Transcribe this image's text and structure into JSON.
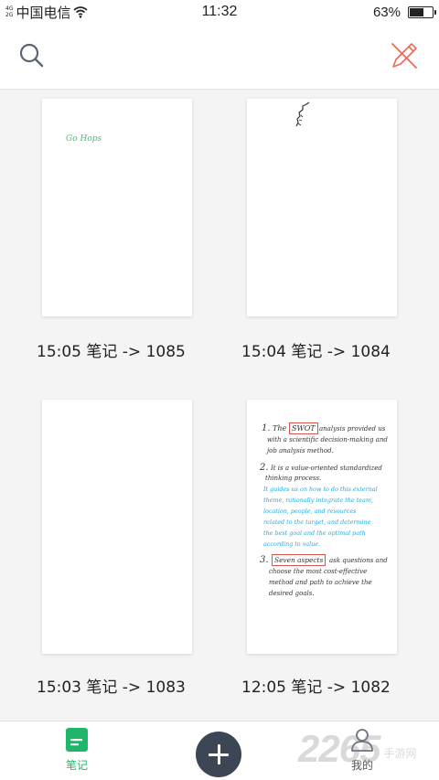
{
  "status_bar": {
    "network_top": "4G",
    "network_bottom": "2G",
    "carrier": "中国电信",
    "time": "11:32",
    "battery_percent": "63%",
    "battery_level": 0.63
  },
  "colors": {
    "accent_green": "#1fb56b",
    "clear_icon_red": "#e96a5e",
    "fab": "#3c4655",
    "ink_blue": "#2aa6d6",
    "ink_green": "#47c06a"
  },
  "notes": [
    {
      "title": "15:05 笔记 -> 1085",
      "sketch_text": "Go Hops"
    },
    {
      "title": "15:04 笔记 -> 1084"
    },
    {
      "title": "15:03 笔记 -> 1083"
    },
    {
      "title": "12:05 笔记 -> 1082",
      "handwriting": {
        "p1_num": "1.",
        "p1_l1a": "The",
        "p1_l1_boxed": "SWOT",
        "p1_l1b": "analysis provided us",
        "p1_l2": "with a scientific decision-making and",
        "p1_l3": "job analysis method.",
        "p2_num": "2.",
        "p2_l1": "It is a value-oriented standardized",
        "p2_l2": "thinking process.",
        "p2_blue_1": "It guides us on how to do this external",
        "p2_blue_2": "theme, rationally integrate the team,",
        "p2_blue_3": "location, people, and resources",
        "p2_blue_4": "related to the target, and determine",
        "p2_blue_5": "the best goal and the optimal path",
        "p2_blue_6": "according to value.",
        "p3_num": "3.",
        "p3_l1_boxed": "Seven aspects",
        "p3_l1b": "ask questions and",
        "p3_l2": "choose the most cost-effective",
        "p3_l3": "method and path to achieve the",
        "p3_l4": "desired goals."
      }
    }
  ],
  "bottom_nav": {
    "notes_label": "笔记",
    "me_label": "我的"
  },
  "watermark": {
    "number": "2265",
    "text": "手游网"
  }
}
